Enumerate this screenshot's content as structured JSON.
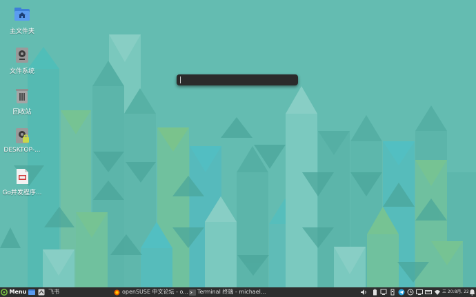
{
  "desktop": {
    "icons": [
      {
        "label": "主文件夹",
        "icon": "home-folder-icon"
      },
      {
        "label": "文件系统",
        "icon": "drive-icon"
      },
      {
        "label": "回收站",
        "icon": "trash-icon"
      },
      {
        "label": "DESKTOP-...",
        "icon": "network-drive-icon"
      },
      {
        "label": "Go并发程序...",
        "icon": "pdf-file-icon"
      }
    ]
  },
  "run_dialog": {
    "value": ""
  },
  "taskbar": {
    "menu_label": "Menu",
    "launchers": [
      {
        "icon": "file-manager-icon"
      },
      {
        "icon": "app-icon"
      }
    ],
    "pinned_label": "飞书",
    "windows": [
      {
        "label": "openSUSE 中文论坛 - o...",
        "icon": "firefox-icon"
      },
      {
        "label": "Terminal 终端 - michael...",
        "icon": "terminal-icon"
      }
    ],
    "tray_icons": [
      "speaker-icon",
      "battery-icon",
      "network-icon",
      "usb-icon",
      "telegram-icon",
      "clock-tray-icon",
      "display-icon",
      "keyboard-icon",
      "wifi-icon"
    ],
    "datetime": "三 20:8月, 22:38",
    "notification_icon": "notification-bell-icon"
  },
  "colors": {
    "wallpaper": "#64bcb1",
    "taskbar": "#2e2e2e",
    "accent_green": "#7bc043"
  }
}
